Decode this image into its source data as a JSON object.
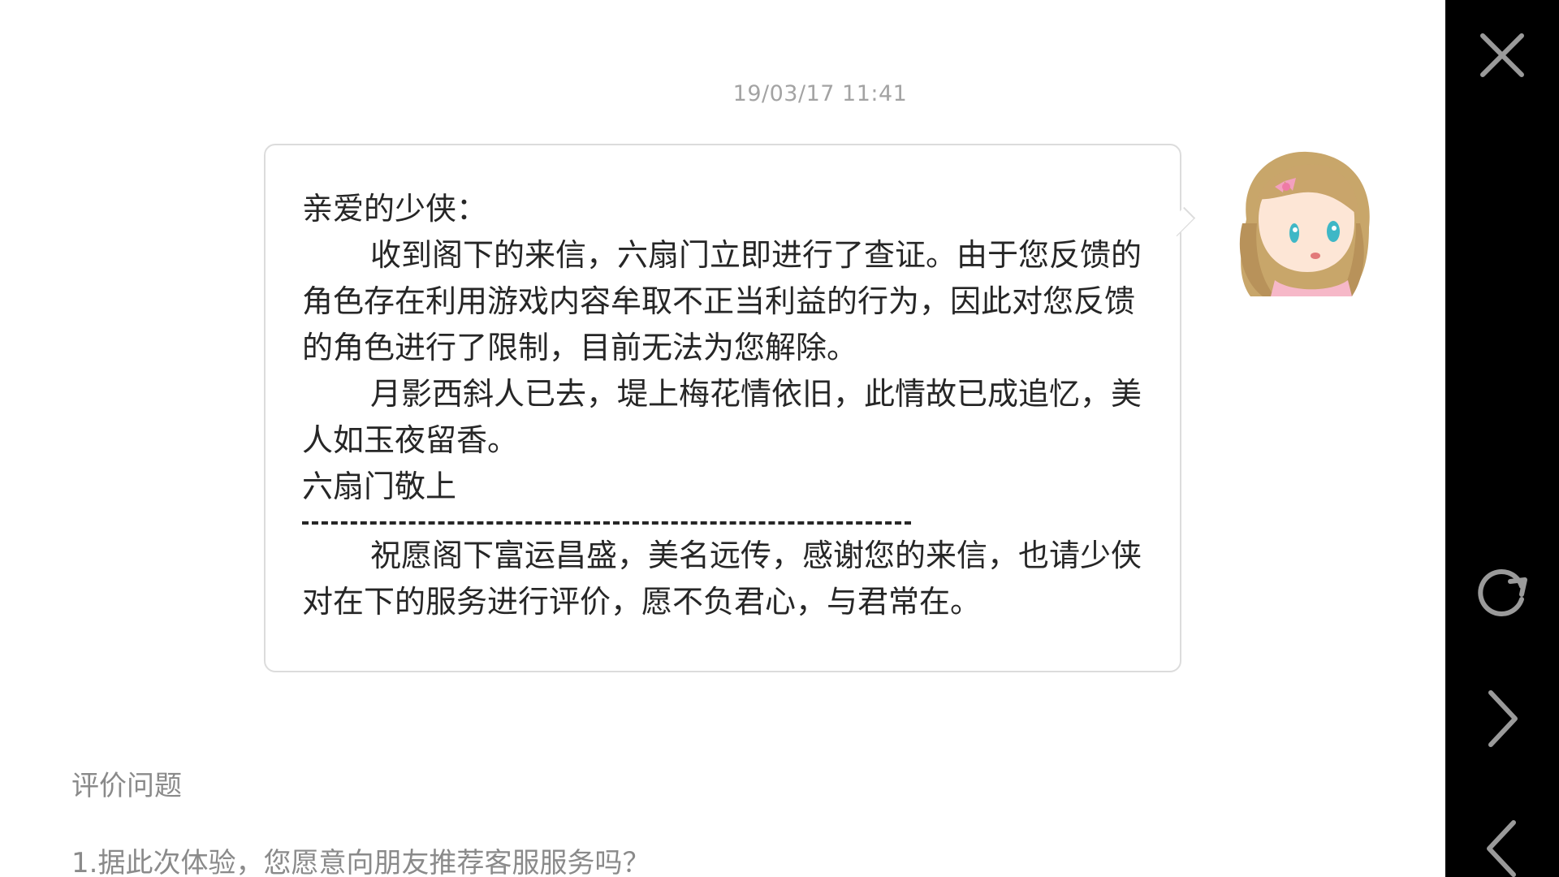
{
  "chat": {
    "timestamp": "19/03/17 11:41",
    "message": {
      "greeting": "亲爱的少侠：",
      "paragraph1": "收到阁下的来信，六扇门立即进行了查证。由于您反馈的角色存在利用游戏内容牟取不正当利益的行为，因此对您反馈的角色进行了限制，目前无法为您解除。",
      "paragraph2": "月影西斜人已去，堤上梅花情依旧，此情故已成追忆，美人如玉夜留香。",
      "signature": "六扇门敬上",
      "separator": "————————————————————————",
      "paragraph3": "祝愿阁下富运昌盛，美名远传，感谢您的来信，也请少侠对在下的服务进行评价，愿不负君心，与君常在。"
    }
  },
  "rating": {
    "title": "评价问题",
    "question1": "1.据此次体验，您愿意向朋友推荐客服服务吗？"
  },
  "sidebar": {
    "icons": [
      "close-icon",
      "refresh-icon",
      "forward-icon",
      "back-icon"
    ]
  },
  "colors": {
    "sidebar_bg": "#000000",
    "icon": "#9a9a9a",
    "text": "#262626",
    "muted": "#8a8a8a"
  }
}
